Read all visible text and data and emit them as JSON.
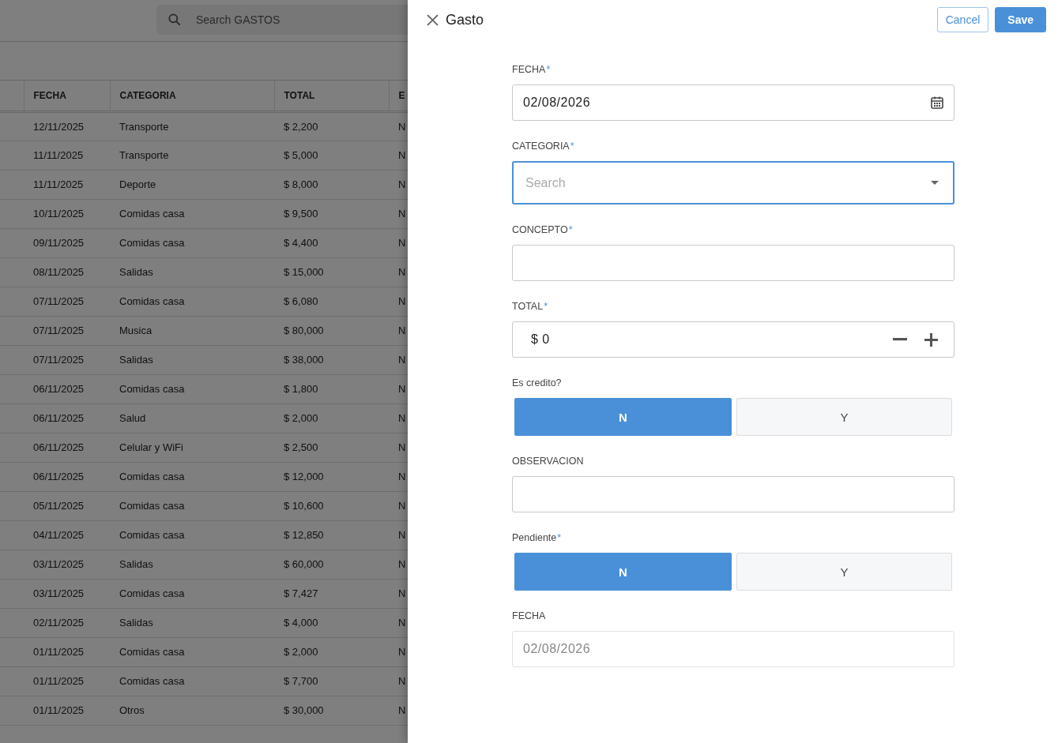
{
  "background": {
    "search": {
      "placeholder": "Search GASTOS"
    },
    "table": {
      "columns": [
        "FECHA",
        "CATEGORIA",
        "TOTAL",
        "E"
      ],
      "rows": [
        {
          "fecha": "12/11/2025",
          "categoria": "Transporte",
          "total": "$ 2,200",
          "column_4": "N"
        },
        {
          "fecha": "11/11/2025",
          "categoria": "Transporte",
          "total": "$ 5,000",
          "column_4": "N"
        },
        {
          "fecha": "11/11/2025",
          "categoria": "Deporte",
          "total": "$ 8,000",
          "column_4": "N"
        },
        {
          "fecha": "10/11/2025",
          "categoria": "Comidas casa",
          "total": "$ 9,500",
          "column_4": "N"
        },
        {
          "fecha": "09/11/2025",
          "categoria": "Comidas casa",
          "total": "$ 4,400",
          "column_4": "N"
        },
        {
          "fecha": "08/11/2025",
          "categoria": "Salidas",
          "total": "$ 15,000",
          "column_4": "N"
        },
        {
          "fecha": "07/11/2025",
          "categoria": "Comidas casa",
          "total": "$ 6,080",
          "column_4": "N"
        },
        {
          "fecha": "07/11/2025",
          "categoria": "Musica",
          "total": "$ 80,000",
          "column_4": "N"
        },
        {
          "fecha": "07/11/2025",
          "categoria": "Salidas",
          "total": "$ 38,000",
          "column_4": "N"
        },
        {
          "fecha": "06/11/2025",
          "categoria": "Comidas casa",
          "total": "$ 1,800",
          "column_4": "N"
        },
        {
          "fecha": "06/11/2025",
          "categoria": "Salud",
          "total": "$ 2,000",
          "column_4": "N"
        },
        {
          "fecha": "06/11/2025",
          "categoria": "Celular y WiFi",
          "total": "$ 2,500",
          "column_4": "N"
        },
        {
          "fecha": "06/11/2025",
          "categoria": "Comidas casa",
          "total": "$ 12,000",
          "column_4": "N"
        },
        {
          "fecha": "05/11/2025",
          "categoria": "Comidas casa",
          "total": "$ 10,600",
          "column_4": "N"
        },
        {
          "fecha": "04/11/2025",
          "categoria": "Comidas casa",
          "total": "$ 12,850",
          "column_4": "N"
        },
        {
          "fecha": "03/11/2025",
          "categoria": "Salidas",
          "total": "$ 60,000",
          "column_4": "N"
        },
        {
          "fecha": "03/11/2025",
          "categoria": "Comidas casa",
          "total": "$ 7,427",
          "column_4": "N"
        },
        {
          "fecha": "02/11/2025",
          "categoria": "Salidas",
          "total": "$ 4,000",
          "column_4": "N"
        },
        {
          "fecha": "01/11/2025",
          "categoria": "Comidas casa",
          "total": "$ 2,000",
          "column_4": "N"
        },
        {
          "fecha": "01/11/2025",
          "categoria": "Comidas casa",
          "total": "$ 7,700",
          "column_4": "N"
        },
        {
          "fecha": "01/11/2025",
          "categoria": "Otros",
          "total": "$ 30,000",
          "column_4": "N"
        }
      ]
    }
  },
  "panel": {
    "title": "Gasto",
    "buttons": [
      {
        "label": "Cancel",
        "kind": "secondary"
      },
      {
        "label": "Save",
        "kind": "primary"
      }
    ],
    "fields": [
      {
        "kind": "date",
        "label": "FECHA",
        "required_mark": "*",
        "value": "02/08/2026",
        "disabled": false
      },
      {
        "kind": "select",
        "label": "CATEGORIA",
        "required_mark": "*",
        "placeholder": "Search",
        "focused": true
      },
      {
        "kind": "text",
        "label": "CONCEPTO",
        "required_mark": "*"
      },
      {
        "kind": "money",
        "label": "TOTAL",
        "required_mark": "*",
        "prefix": "$",
        "value": "0"
      },
      {
        "kind": "toggle",
        "label": "Es credito?",
        "options": [
          {
            "label": "N",
            "selected": true
          },
          {
            "label": "Y",
            "selected": false
          }
        ]
      },
      {
        "kind": "text",
        "label": "OBSERVACION"
      },
      {
        "kind": "toggle",
        "label": "Pendiente",
        "required_mark": "*",
        "options": [
          {
            "label": "N",
            "selected": true
          },
          {
            "label": "Y",
            "selected": false
          }
        ]
      },
      {
        "kind": "date",
        "label": "FECHA",
        "value": "02/08/2026",
        "disabled": true
      }
    ]
  }
}
